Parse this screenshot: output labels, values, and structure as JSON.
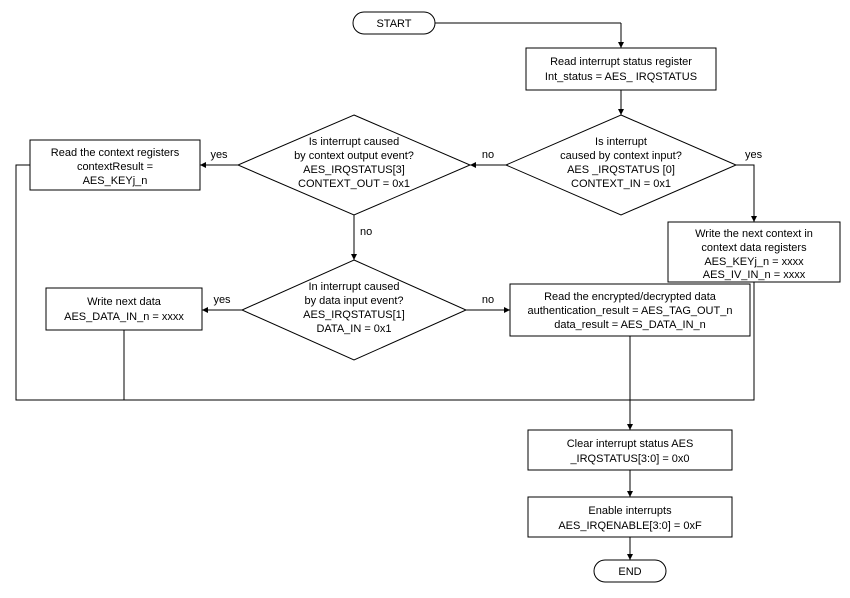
{
  "start": "START",
  "end": "END",
  "read_status": {
    "l1": "Read interrupt status register",
    "l2": "Int_status = AES_ IRQSTATUS"
  },
  "dec_ctx_in": {
    "l1": "Is interrupt",
    "l2": "caused by context input?",
    "l3": "AES _IRQSTATUS [0]",
    "l4": "CONTEXT_IN = 0x1"
  },
  "dec_ctx_out": {
    "l1": "Is interrupt caused",
    "l2": "by context output event?",
    "l3": "AES_IRQSTATUS[3]",
    "l4": "CONTEXT_OUT = 0x1"
  },
  "dec_data_in": {
    "l1": "In interrupt caused",
    "l2": "by data input event?",
    "l3": "AES_IRQSTATUS[1]",
    "l4": "DATA_IN = 0x1"
  },
  "write_ctx": {
    "l1": "Write the next context in",
    "l2": "context data registers",
    "l3": "AES_KEYj_n = xxxx",
    "l4": "AES_IV_IN_n = xxxx"
  },
  "read_ctx": {
    "l1": "Read the context registers",
    "l2": "contextResult =",
    "l3": "AES_KEYj_n"
  },
  "write_data": {
    "l1": "Write next data",
    "l2": "AES_DATA_IN_n = xxxx"
  },
  "read_data": {
    "l1": "Read the encrypted/decrypted data",
    "l2": "authentication_result = AES_TAG_OUT_n",
    "l3": "data_result = AES_DATA_IN_n"
  },
  "clear_irq": {
    "l1": "Clear interrupt status AES",
    "l2": "_IRQSTATUS[3:0] = 0x0"
  },
  "enable_irq": {
    "l1": "Enable interrupts",
    "l2": "AES_IRQENABLE[3:0]  = 0xF"
  },
  "labels": {
    "yes": "yes",
    "no": "no"
  }
}
